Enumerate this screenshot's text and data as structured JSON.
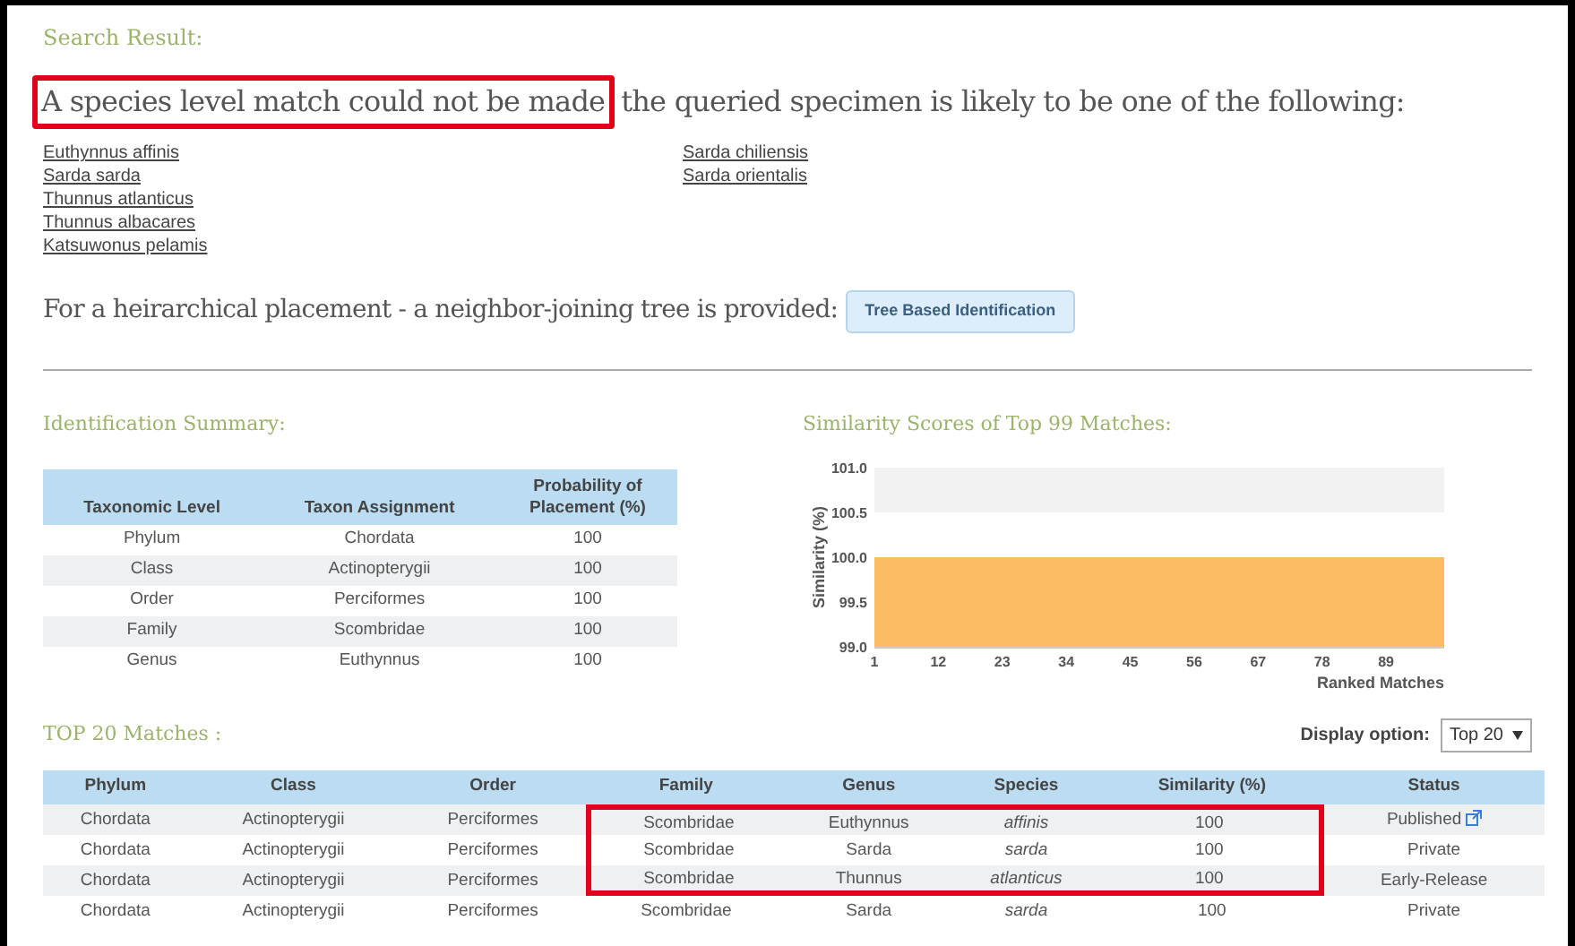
{
  "search_result": {
    "title": "Search Result:",
    "headline_highlighted": "A species level match could not be made",
    "headline_rest": "the queried specimen is likely to be one of the following:",
    "candidates": [
      {
        "name": "Euthynnus affinis"
      },
      {
        "name": "Sarda sarda"
      },
      {
        "name": "Thunnus atlanticus"
      },
      {
        "name": "Thunnus albacares"
      },
      {
        "name": "Katsuwonus pelamis"
      },
      {
        "name": "Sarda chiliensis"
      },
      {
        "name": "Sarda orientalis"
      }
    ],
    "tree_text": "For a heirarchical placement - a neighbor-joining tree is provided:",
    "tree_button": "Tree Based Identification"
  },
  "summary": {
    "title": "Identification Summary:",
    "columns": [
      "Taxonomic Level",
      "Taxon Assignment",
      "Probability of Placement (%)"
    ],
    "rows": [
      [
        "Phylum",
        "Chordata",
        "100"
      ],
      [
        "Class",
        "Actinopterygii",
        "100"
      ],
      [
        "Order",
        "Perciformes",
        "100"
      ],
      [
        "Family",
        "Scombridae",
        "100"
      ],
      [
        "Genus",
        "Euthynnus",
        "100"
      ]
    ]
  },
  "similarity": {
    "title": "Similarity Scores of Top 99 Matches:",
    "chart_data": {
      "type": "area",
      "xlabel": "Ranked Matches",
      "ylabel": "Similarity (%)",
      "x": [
        1,
        99
      ],
      "series": [
        {
          "color": "#fbbd63",
          "values": [
            100,
            100
          ]
        }
      ],
      "xlim": [
        1,
        99
      ],
      "ylim": [
        99,
        101
      ],
      "xticks": [
        1,
        12,
        23,
        34,
        45,
        56,
        67,
        78,
        89
      ],
      "yticks": [
        {
          "value": 99,
          "label": "99.0"
        },
        {
          "value": 99.5,
          "label": "99.5"
        },
        {
          "value": 100,
          "label": "100.0"
        },
        {
          "value": 100.5,
          "label": "100.5"
        },
        {
          "value": 101,
          "label": "101.0"
        }
      ]
    }
  },
  "matches": {
    "title": "TOP 20 Matches :",
    "display_label": "Display option:",
    "display_value": "Top 20",
    "columns": [
      {
        "label": "Phylum",
        "highlighted": false
      },
      {
        "label": "Class",
        "highlighted": false
      },
      {
        "label": "Order",
        "highlighted": false
      },
      {
        "label": "Family",
        "highlighted": true
      },
      {
        "label": "Genus",
        "highlighted": true
      },
      {
        "label": "Species",
        "highlighted": true
      },
      {
        "label": "Similarity (%)",
        "highlighted": true
      },
      {
        "label": "Status",
        "highlighted": false
      }
    ],
    "rows": [
      {
        "cells": [
          "Chordata",
          "Actinopterygii",
          "Perciformes",
          "Scombridae",
          "Euthynnus",
          "affinis",
          "100",
          "Published"
        ],
        "link": true,
        "highlighted": true
      },
      {
        "cells": [
          "Chordata",
          "Actinopterygii",
          "Perciformes",
          "Scombridae",
          "Sarda",
          "sarda",
          "100",
          "Private"
        ],
        "link": false,
        "highlighted": true
      },
      {
        "cells": [
          "Chordata",
          "Actinopterygii",
          "Perciformes",
          "Scombridae",
          "Thunnus",
          "atlanticus",
          "100",
          "Early-Release"
        ],
        "link": false,
        "highlighted": true
      },
      {
        "cells": [
          "Chordata",
          "Actinopterygii",
          "Perciformes",
          "Scombridae",
          "Sarda",
          "sarda",
          "100",
          "Private"
        ],
        "link": false,
        "highlighted": false
      }
    ]
  }
}
